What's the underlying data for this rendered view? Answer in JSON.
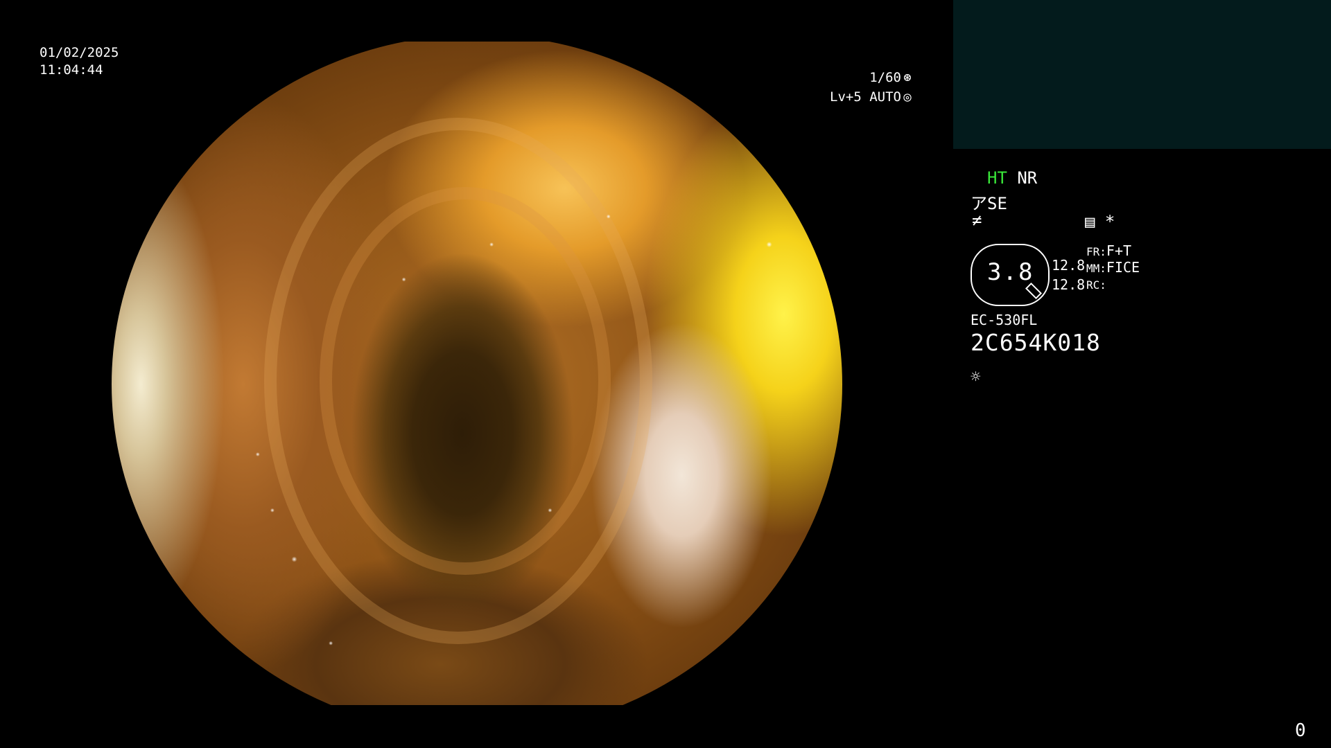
{
  "overlay": {
    "date": "01/02/2025",
    "time": "11:04:44",
    "shutter": "1/60",
    "shutter_icon": "aperture-icon",
    "level": "Lv+5 AUTO",
    "level_icon": "auto-iris-icon"
  },
  "panel": {
    "ht_label": "HT",
    "nr_label": "NR",
    "se_label": "SE",
    "structure_icon": "structure-enhance-icon",
    "freeze_icon": "freeze-icon",
    "memo_icon": "memo-icon",
    "asterisk": "*",
    "zoom": "3.8",
    "value_a": "12.8",
    "value_b": "12.8",
    "fr_label": "FR:",
    "fr_value": "F+T",
    "mm_label": "MM:",
    "mm_value": "FICE",
    "rc_label": "RC:",
    "model": "EC-530FL",
    "serial": "2C654K018",
    "light_icon": "light-source-icon",
    "counter": "0"
  },
  "colors": {
    "background": "#000000",
    "ht_green": "#39e639",
    "thumb_box": "#031b1c"
  }
}
